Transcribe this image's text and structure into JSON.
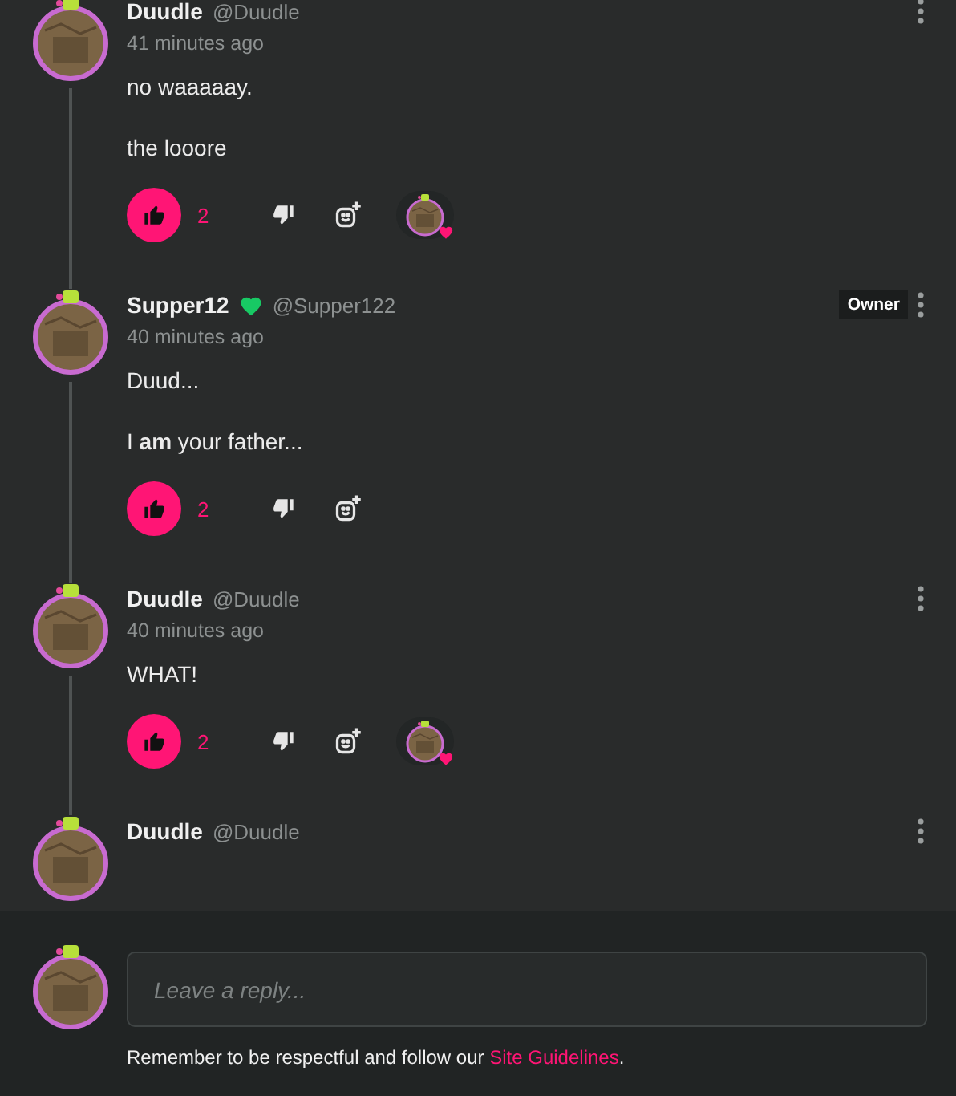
{
  "comments": [
    {
      "author": "Duudle",
      "handle": "@Duudle",
      "time": "41 minutes ago",
      "paragraphs": [
        "no waaaaay.",
        "the looore"
      ],
      "likes": "2",
      "liked": true,
      "reacted": true
    },
    {
      "author": "Supper12",
      "handle": "@Supper122",
      "heart": true,
      "badge": "Owner",
      "time": "40 minutes ago",
      "paragraphs": [
        "Duud...",
        "I **am** your father..."
      ],
      "likes": "2",
      "liked": true
    },
    {
      "author": "Duudle",
      "handle": "@Duudle",
      "time": "40 minutes ago",
      "paragraphs": [
        "WHAT!"
      ],
      "likes": "2",
      "liked": true,
      "reacted": true
    },
    {
      "author": "Duudle",
      "handle": "@Duudle"
    }
  ],
  "composer": {
    "placeholder": "Leave a reply...",
    "note": "Remember to be respectful and follow our",
    "link": "Site Guidelines",
    "note_end": "."
  }
}
